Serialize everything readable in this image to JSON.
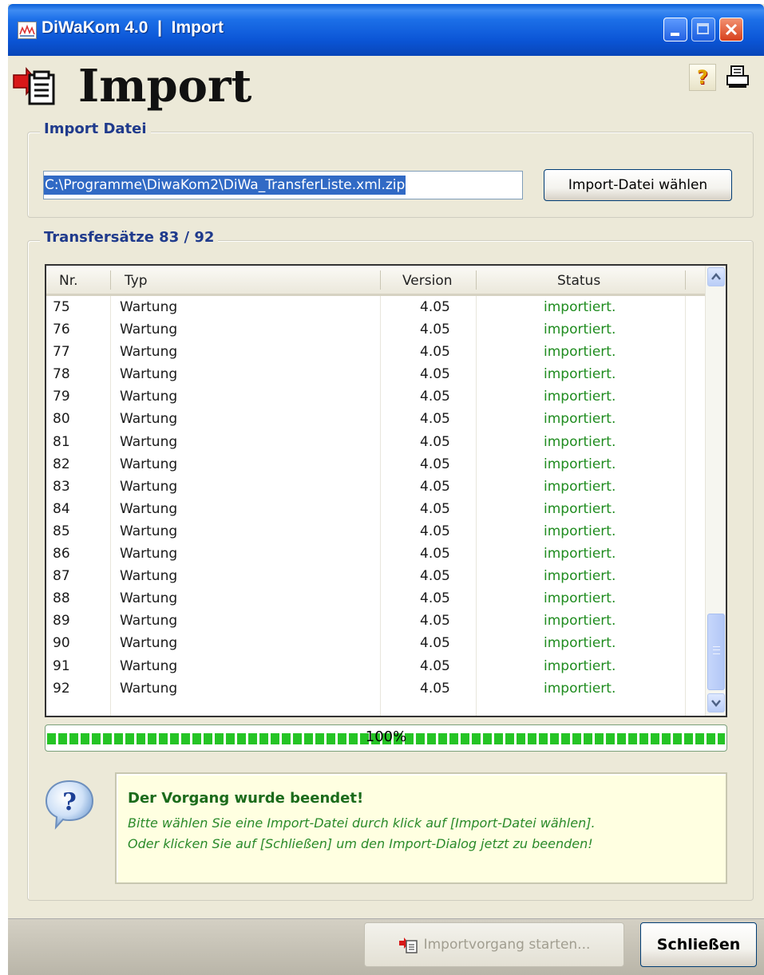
{
  "window": {
    "title": "DiWaKom 4.0  |  Import",
    "controls": [
      "minimize-icon",
      "maximize-icon",
      "close-icon"
    ]
  },
  "header": {
    "title": "Import",
    "help_glyph": "?",
    "icons": [
      "import-icon",
      "help-icon",
      "print-icon"
    ]
  },
  "import_file": {
    "group_label": "Import Datei",
    "path_value": "C:\\Programme\\DiwaKom2\\DiWa_TransferListe.xml.zip",
    "choose_button": "Import-Datei wählen"
  },
  "transfers": {
    "group_label": "Transfersätze 83 / 92",
    "columns": [
      "Nr.",
      "Typ",
      "Version",
      "Status"
    ],
    "rows": [
      {
        "nr": "75",
        "typ": "Wartung",
        "version": "4.05",
        "status": "importiert."
      },
      {
        "nr": "76",
        "typ": "Wartung",
        "version": "4.05",
        "status": "importiert."
      },
      {
        "nr": "77",
        "typ": "Wartung",
        "version": "4.05",
        "status": "importiert."
      },
      {
        "nr": "78",
        "typ": "Wartung",
        "version": "4.05",
        "status": "importiert."
      },
      {
        "nr": "79",
        "typ": "Wartung",
        "version": "4.05",
        "status": "importiert."
      },
      {
        "nr": "80",
        "typ": "Wartung",
        "version": "4.05",
        "status": "importiert."
      },
      {
        "nr": "81",
        "typ": "Wartung",
        "version": "4.05",
        "status": "importiert."
      },
      {
        "nr": "82",
        "typ": "Wartung",
        "version": "4.05",
        "status": "importiert."
      },
      {
        "nr": "83",
        "typ": "Wartung",
        "version": "4.05",
        "status": "importiert."
      },
      {
        "nr": "84",
        "typ": "Wartung",
        "version": "4.05",
        "status": "importiert."
      },
      {
        "nr": "85",
        "typ": "Wartung",
        "version": "4.05",
        "status": "importiert."
      },
      {
        "nr": "86",
        "typ": "Wartung",
        "version": "4.05",
        "status": "importiert."
      },
      {
        "nr": "87",
        "typ": "Wartung",
        "version": "4.05",
        "status": "importiert."
      },
      {
        "nr": "88",
        "typ": "Wartung",
        "version": "4.05",
        "status": "importiert."
      },
      {
        "nr": "89",
        "typ": "Wartung",
        "version": "4.05",
        "status": "importiert."
      },
      {
        "nr": "90",
        "typ": "Wartung",
        "version": "4.05",
        "status": "importiert."
      },
      {
        "nr": "91",
        "typ": "Wartung",
        "version": "4.05",
        "status": "importiert."
      },
      {
        "nr": "92",
        "typ": "Wartung",
        "version": "4.05",
        "status": "importiert."
      }
    ]
  },
  "progress": {
    "label": "100%",
    "fraction": 1.0
  },
  "message": {
    "title": "Der Vorgang wurde beendet!",
    "line1": "Bitte wählen Sie eine Import-Datei durch klick auf [Import-Datei wählen].",
    "line2": "Oder klicken Sie auf [Schließen] um den Import-Dialog jetzt zu beenden!",
    "icon": "question-bubble-icon"
  },
  "buttons": {
    "start": "Importvorgang starten...",
    "close": "Schließen"
  },
  "colors": {
    "title_bar": "#0b55d6",
    "status_text": "#1f8c1f",
    "progress_fill": "#25c425",
    "message_bg": "#ffffe1",
    "group_label": "#1f3a8c"
  }
}
